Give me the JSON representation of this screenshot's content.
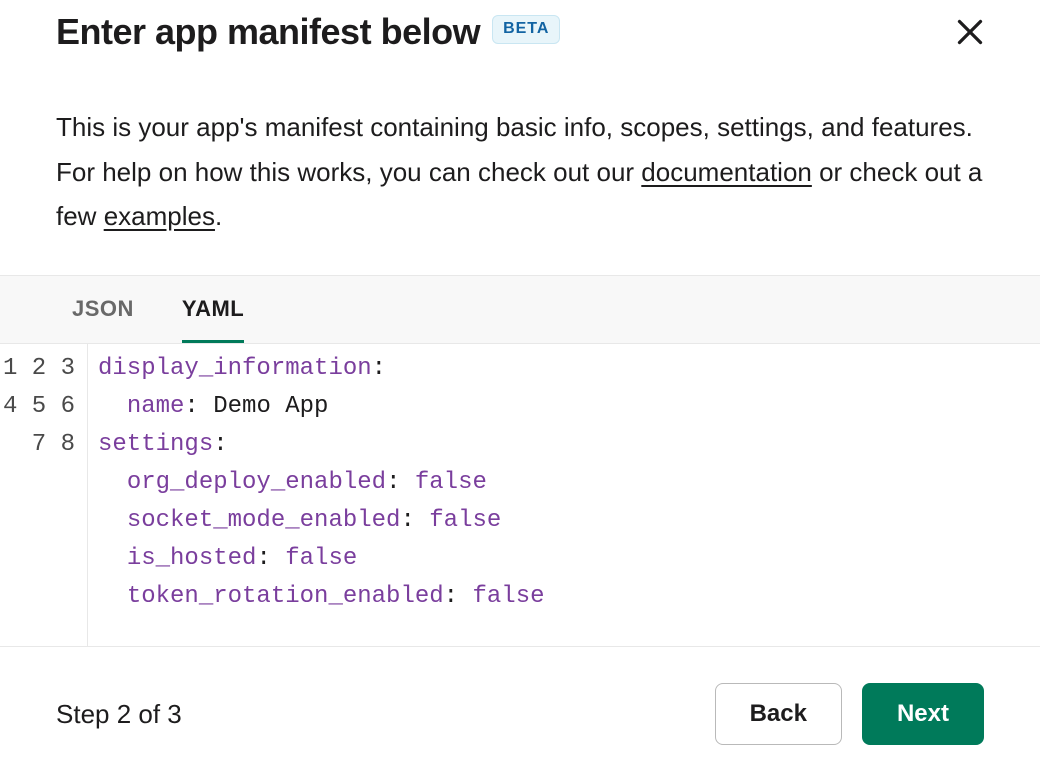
{
  "header": {
    "title": "Enter app manifest below",
    "badge": "BETA"
  },
  "description": {
    "part1": "This is your app's manifest containing basic info, scopes, settings, and features. For help on how this works, you can check out our ",
    "link1": "documentation",
    "part2": " or check out a few ",
    "link2": "examples",
    "part3": "."
  },
  "tabs": {
    "json": "JSON",
    "yaml": "YAML"
  },
  "editor": {
    "line_numbers": [
      "1",
      "2",
      "3",
      "4",
      "5",
      "6",
      "7",
      "8"
    ],
    "lines": [
      {
        "indent": "",
        "key": "display_information",
        "value": null,
        "is_bool": false
      },
      {
        "indent": "  ",
        "key": "name",
        "value": "Demo App",
        "is_bool": false
      },
      {
        "indent": "",
        "key": "settings",
        "value": null,
        "is_bool": false
      },
      {
        "indent": "  ",
        "key": "org_deploy_enabled",
        "value": "false",
        "is_bool": true
      },
      {
        "indent": "  ",
        "key": "socket_mode_enabled",
        "value": "false",
        "is_bool": true
      },
      {
        "indent": "  ",
        "key": "is_hosted",
        "value": "false",
        "is_bool": true
      },
      {
        "indent": "  ",
        "key": "token_rotation_enabled",
        "value": "false",
        "is_bool": true
      },
      {
        "indent": "",
        "key": null,
        "value": null,
        "is_bool": false
      }
    ]
  },
  "footer": {
    "step": "Step 2 of 3",
    "back": "Back",
    "next": "Next"
  }
}
